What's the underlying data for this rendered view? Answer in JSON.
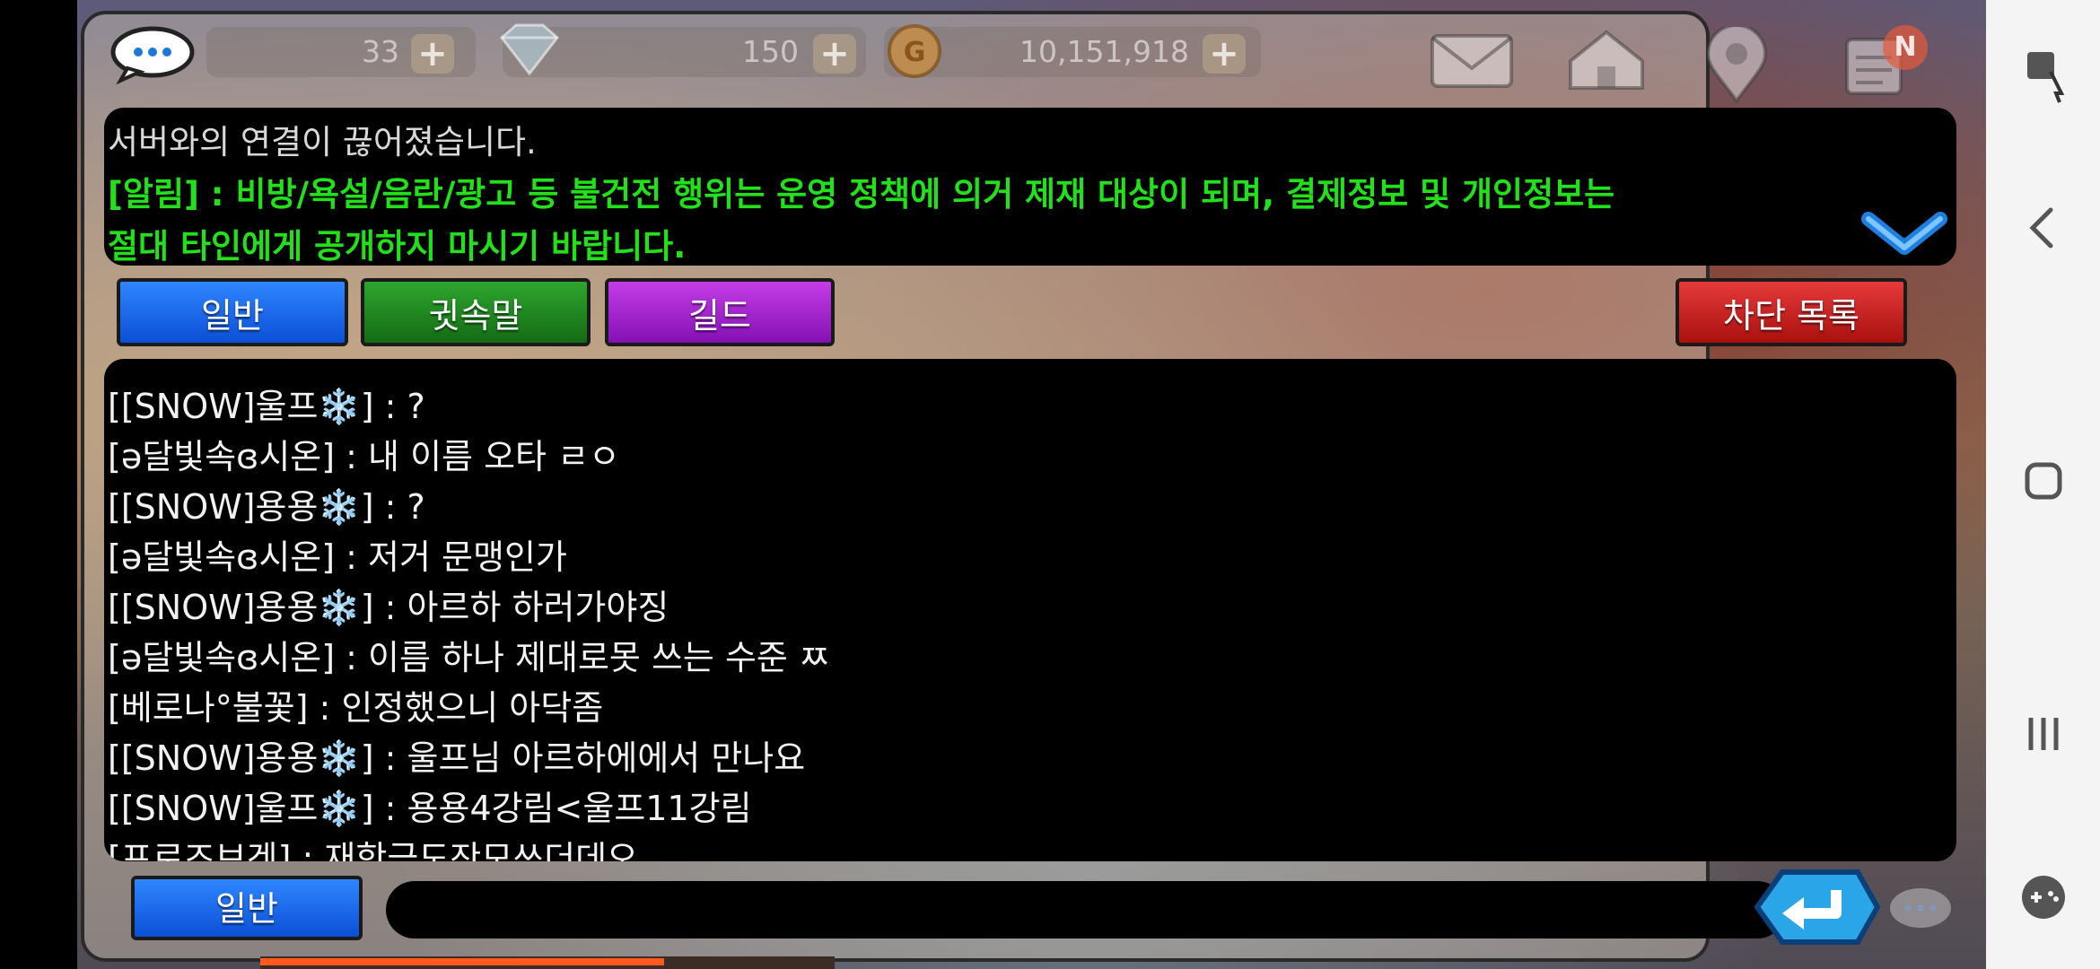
{
  "currency": {
    "stamina": "33",
    "diamond": "150",
    "gold": "10,151,918",
    "notification_badge": "N"
  },
  "notice": {
    "system_message": "서버와의 연결이 끊어졌습니다.",
    "alert_line1": "[알림] : 비방/욕설/음란/광고 등 불건전 행위는 운영 정책에 의거 제재 대상이 되며, 결제정보 및 개인정보는",
    "alert_line2": "절대 타인에게 공개하지 마시기 바랍니다."
  },
  "tabs": {
    "general": "일반",
    "whisper": "귓속말",
    "guild": "길드",
    "block_list": "차단 목록"
  },
  "chat": {
    "messages": [
      "[[SNOW]울프❄️] : ?",
      "[ə달빛속ɞ시온] : 내 이름 오타 ㄹㅇ",
      "[[SNOW]용용❄️] : ?",
      "[ə달빛속ɞ시온] : 저거 문맹인가",
      "[[SNOW]용용❄️] : 아르하 하러가야징",
      "[ə달빛속ɞ시온] : 이름 하나 제대로못 쓰는 수준 ㅉ",
      "[베로나°불꽃] : 인정했으니 아닥좀",
      "[[SNOW]용용❄️] : 울프님 아르하에에서 만나요",
      "[[SNOW]울프❄️] : 용용4강림<울프11강림"
    ],
    "partial_bottom": "[프로즈브겐] : 재학금도잔모쓰더데오"
  },
  "input": {
    "channel_label": "일반",
    "placeholder": ""
  },
  "icons": [
    "chat-bubble-icon",
    "diamond-icon",
    "gold-coin-icon",
    "mail-icon",
    "house-icon",
    "map-pin-icon",
    "quest-list-icon",
    "expand-chevron-icon",
    "send-icon",
    "screen-pin-icon",
    "back-icon",
    "home-icon",
    "recents-icon",
    "game-tools-icon"
  ],
  "colors": {
    "alert_green": "#22e01a",
    "tab_blue": "#1f6bf0",
    "tab_green": "#1f8a1f",
    "tab_purple": "#a723d0",
    "tab_red": "#cc1f1f",
    "send_blue": "#2aa6e8"
  }
}
